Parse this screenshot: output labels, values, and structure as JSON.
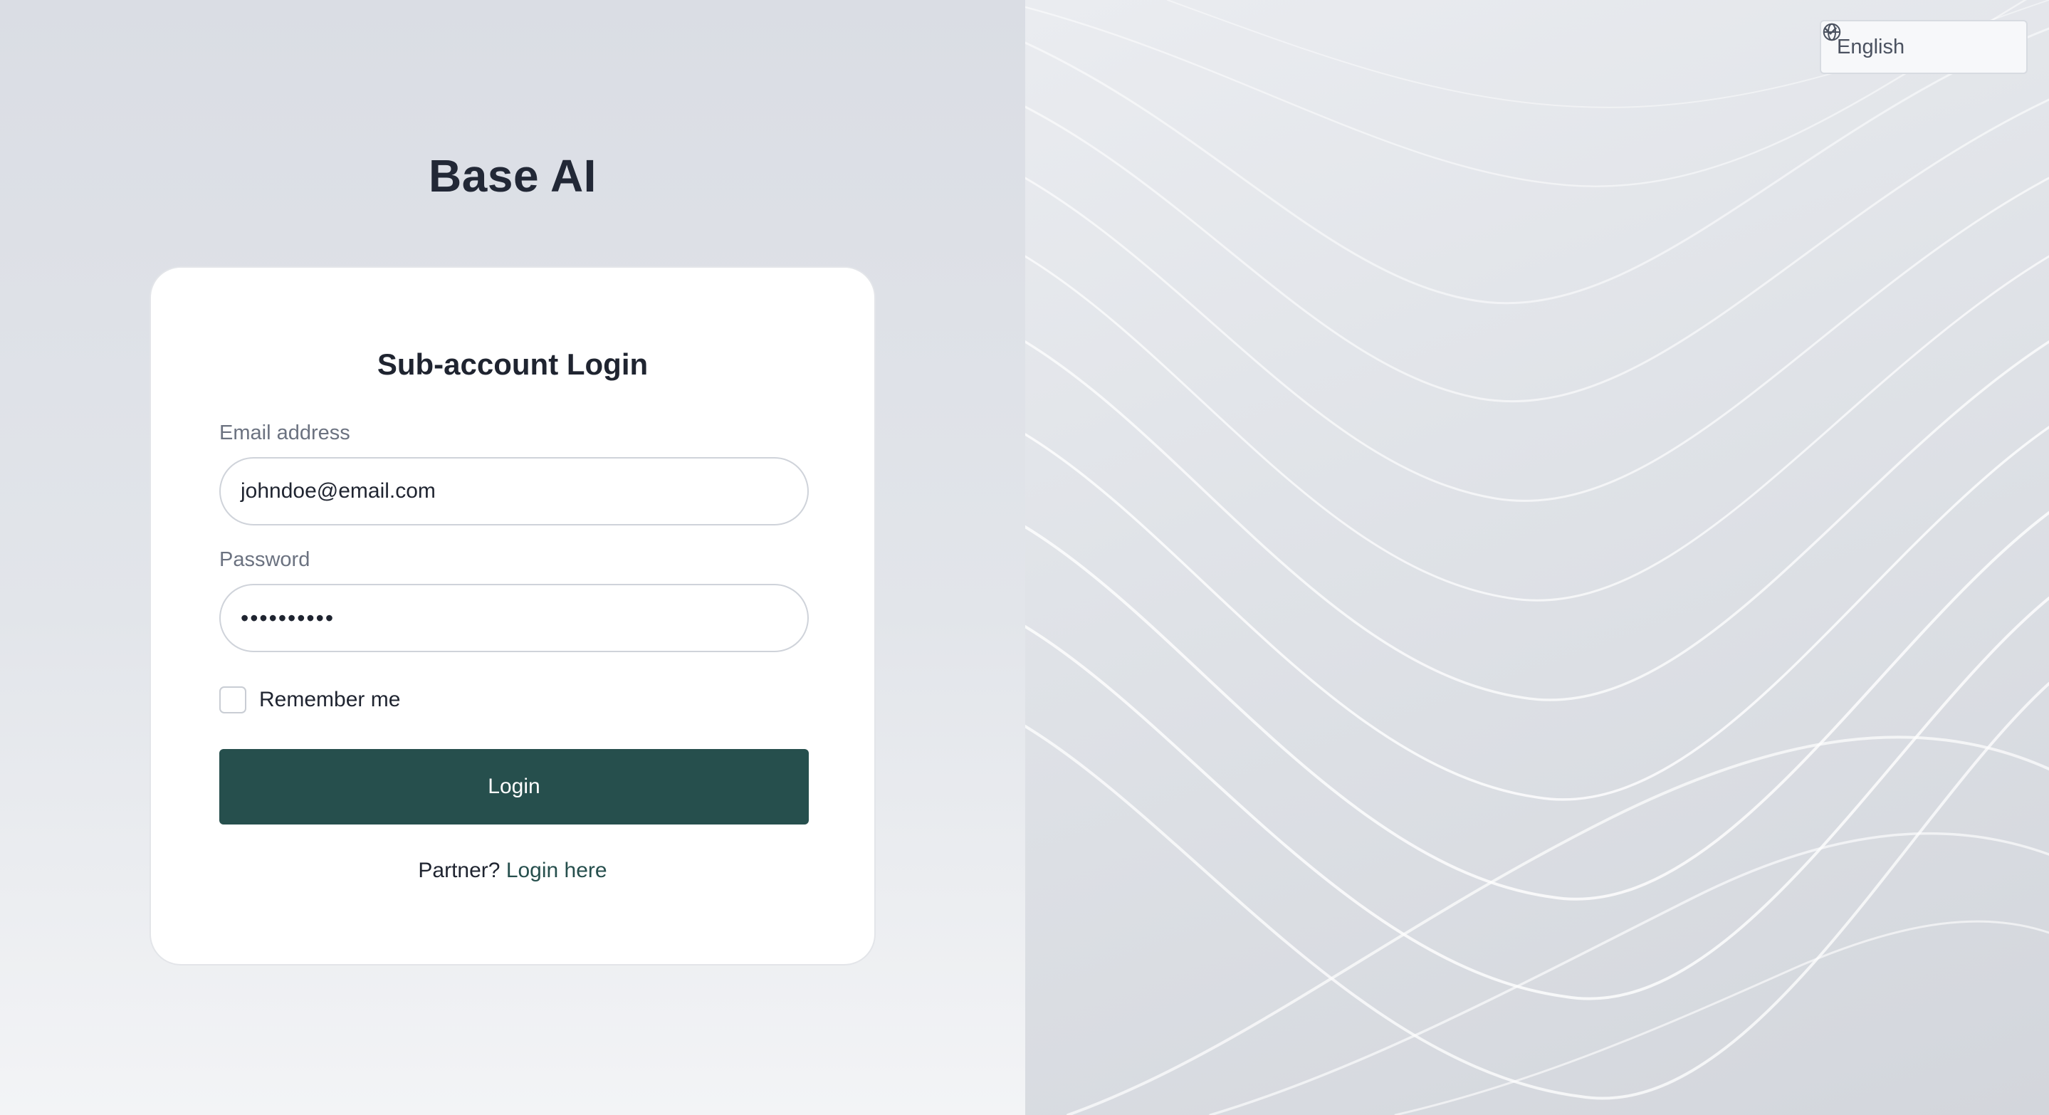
{
  "brand": {
    "title": "Base AI"
  },
  "login_card": {
    "title": "Sub-account Login",
    "email": {
      "label": "Email address",
      "value": "johndoe@email.com"
    },
    "password": {
      "label": "Password",
      "masked_value": "••••••••••"
    },
    "remember": {
      "label": "Remember me",
      "checked": false
    },
    "submit_label": "Login",
    "partner": {
      "prompt": "Partner?",
      "link_text": "Login here"
    }
  },
  "language_selector": {
    "value": "English",
    "icon": "globe-icon",
    "dropdown_icon": "chevron-down-icon"
  },
  "colors": {
    "primary": "#264f4d",
    "link": "#264f4d"
  }
}
